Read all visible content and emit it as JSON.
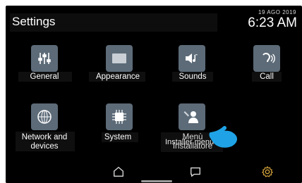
{
  "header": {
    "title": "Settings",
    "date": "19 AGO 2019",
    "time": "6:23 AM"
  },
  "items": [
    {
      "label": "General",
      "icon": "sliders-icon"
    },
    {
      "label": "Appearance",
      "icon": "display-icon"
    },
    {
      "label": "Sounds",
      "icon": "sound-music-icon"
    },
    {
      "label": "Call",
      "icon": "call-ear-icon"
    },
    {
      "label_line1": "Network and",
      "label_line2": "devices",
      "icon": "network-globe-icon"
    },
    {
      "label": "System",
      "icon": "chip-icon"
    },
    {
      "label_line1": "Menù",
      "label_line2": "Installatore",
      "overlay": "Installer menu",
      "icon": "installer-wrench-icon"
    }
  ],
  "navbar": {
    "home": "home-icon",
    "messages": "chat-icon",
    "settings": "gear-icon",
    "active_color": "#d4a23a"
  },
  "colors": {
    "tile": "#5d6b78",
    "pointer": "#1fa3e6"
  }
}
